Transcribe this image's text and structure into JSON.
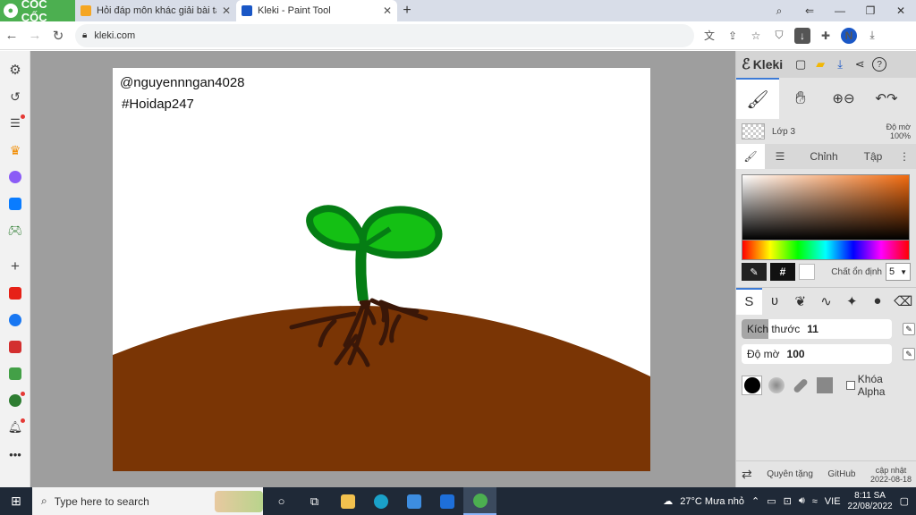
{
  "browser": {
    "brand": "CỐC CỐC",
    "tabs": [
      {
        "label": "Hỏi đáp môn khác giải bài tậ",
        "favicon_color": "#f5a623",
        "active": false
      },
      {
        "label": "Kleki - Paint Tool",
        "favicon_color": "#1a57c6",
        "active": true
      }
    ],
    "url": "kleki.com",
    "profile_initial": "N"
  },
  "sidebar": {
    "items": [
      "settings-icon",
      "history-icon",
      "reading-list-icon",
      "crown-icon",
      "messenger-icon",
      "zalo-icon",
      "game-icon",
      "add-icon",
      "youtube-icon",
      "facebook-icon",
      "calendar-icon",
      "coupon-icon",
      "extension-icon",
      "bell-icon",
      "more-icon"
    ]
  },
  "canvas": {
    "credit_user": "@nguyennngan4028",
    "credit_tag": "#Hoidap247",
    "colors": {
      "soil": "#7a3505",
      "leaf_dark": "#057d14",
      "leaf_light": "#14c014",
      "root": "#3a1708",
      "page_bg": "#9e9e9e"
    }
  },
  "kleki": {
    "title": "Kleki",
    "layer": {
      "name": "Lớp 3",
      "opacity_label": "Độ mờ",
      "opacity_value": "100%"
    },
    "tabs": {
      "adjust": "Chỉnh",
      "file": "Tập"
    },
    "stabilizer_label": "Chất ổn định",
    "stabilizer_value": "5",
    "hex_label": "#",
    "size": {
      "label": "Kích thước",
      "value": "11",
      "fraction": 0.18
    },
    "opacity": {
      "label": "Độ mờ",
      "value": "100",
      "fraction": 1.0
    },
    "lock_alpha": "Khóa Alpha",
    "footer": {
      "help": "Quyên tặng",
      "github": "GitHub",
      "updated_label": "cập nhật",
      "updated_date": "2022-08-18"
    }
  },
  "taskbar": {
    "search_placeholder": "Type here to search",
    "weather": "27°C  Mưa nhỏ",
    "lang": "VIE",
    "time": "8:11 SA",
    "date": "22/08/2022"
  }
}
